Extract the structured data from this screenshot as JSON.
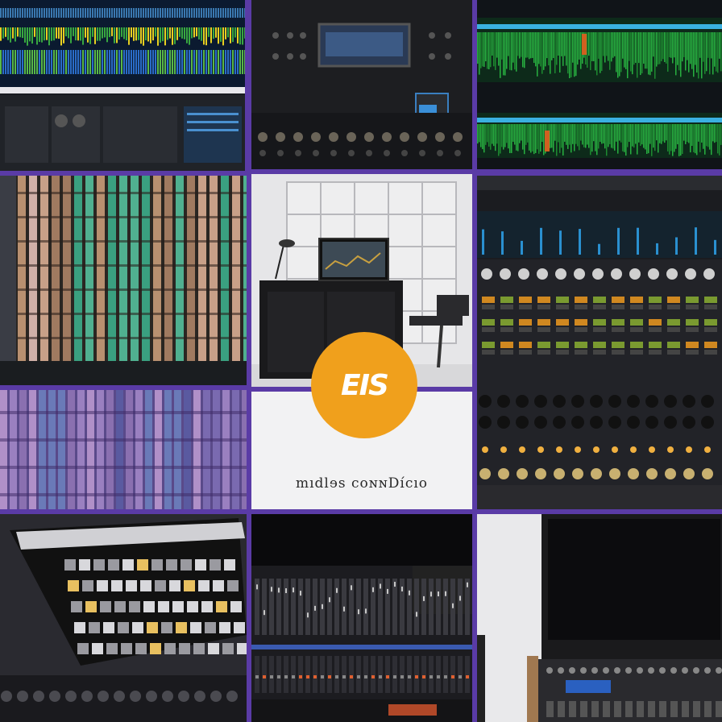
{
  "logo": {
    "text": "EIS",
    "bg": "#f0a01c",
    "fg": "#ffffff"
  },
  "caption": "mıdlɘs coɴɴDícıo",
  "colors": {
    "frame": "#5a3ba6",
    "waveform_green": "#28b040",
    "waveform_blue": "#2a6cc8",
    "waveform_yellow": "#e8d020"
  }
}
